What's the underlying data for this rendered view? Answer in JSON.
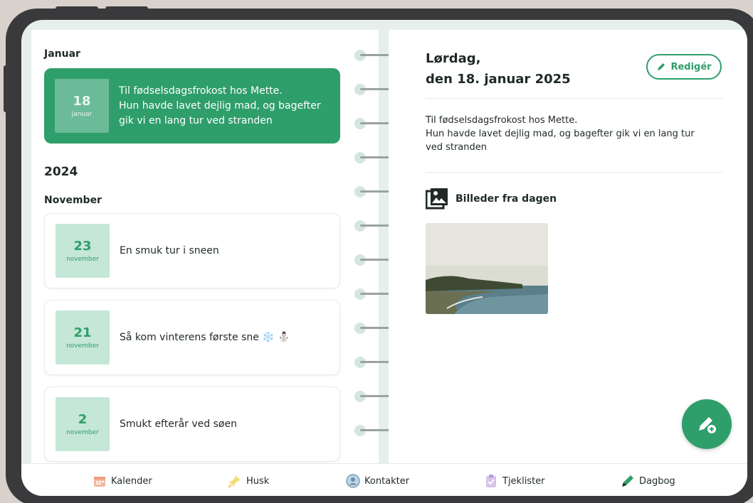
{
  "left_page": {
    "month_january": "Januar",
    "entry_jan": {
      "day": "18",
      "month": "januar",
      "text_lines": [
        "Til fødselsdagsfrokost hos Mette.",
        "Hun havde lavet dejlig mad, og bagefter",
        "gik vi en lang tur ved stranden"
      ]
    },
    "year": "2024",
    "month_november": "November",
    "entries_nov": [
      {
        "day": "23",
        "month": "november",
        "text": "En smuk tur i sneen"
      },
      {
        "day": "21",
        "month": "november",
        "text": "Så kom vinterens første sne ❄️ ⛄"
      },
      {
        "day": "2",
        "month": "november",
        "text": "Smukt efterår ved søen"
      }
    ]
  },
  "right_page": {
    "title_line1": "Lørdag,",
    "title_line2": "den 18. januar 2025",
    "edit_label": "Redigér",
    "body_lines": [
      "Til fødselsdagsfrokost hos Mette.",
      "Hun havde lavet dejlig mad, og bagefter gik vi en lang tur",
      "ved stranden"
    ],
    "photos_heading": "Billeder fra dagen"
  },
  "bottom_nav": {
    "items": [
      {
        "label": "Kalender",
        "icon": "calendar-icon"
      },
      {
        "label": "Husk",
        "icon": "pin-icon"
      },
      {
        "label": "Kontakter",
        "icon": "contacts-icon"
      },
      {
        "label": "Tjeklister",
        "icon": "clipboard-icon"
      },
      {
        "label": "Dagbog",
        "icon": "pen-icon"
      }
    ]
  },
  "colors": {
    "accent": "#2e9e6b",
    "accent_light": "#c5e7d7",
    "background": "#e6efec"
  }
}
